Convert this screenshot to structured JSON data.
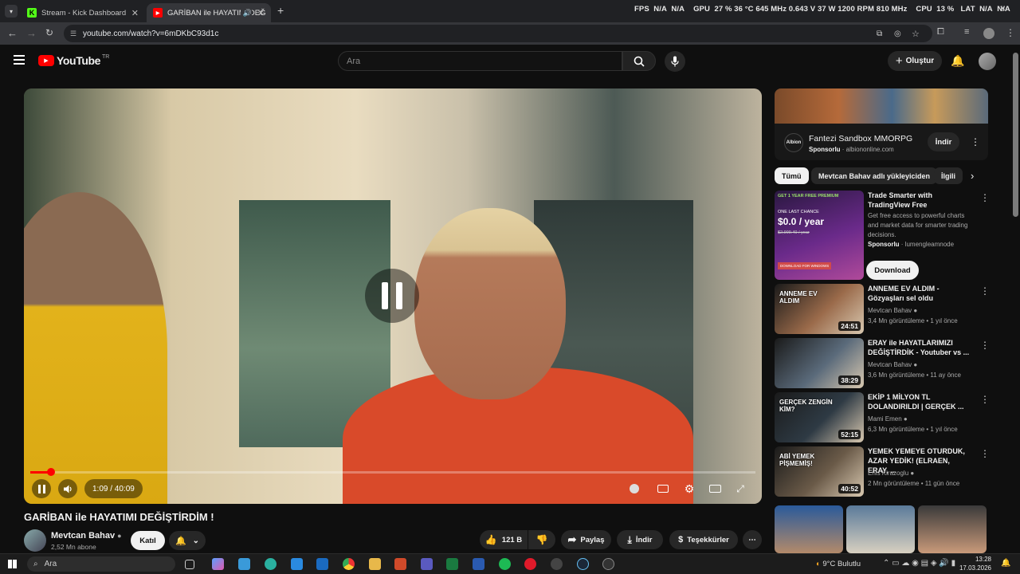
{
  "browser": {
    "tabs": [
      {
        "label": "Stream - Kick Dashboard",
        "favicon_color": "#53fc18"
      },
      {
        "label": "GARİBAN ile HAYATIMI DEĞ",
        "favicon_color": "#ff0000"
      }
    ],
    "new_tab": "+",
    "url": "youtube.com/watch?v=6mDKbC93d1c"
  },
  "overlay": {
    "fps_label": "FPS",
    "fps_1": "N/A",
    "fps_2": "N/A",
    "gpu_label": "GPU",
    "gpu_stats": "27 %  36 °C  645 MHz  0.643 V  37 W  1200 RPM  810 MHz",
    "cpu_label": "CPU",
    "cpu_stats": "13 %",
    "lat_label": "LAT",
    "lat_1": "N/A",
    "lat_2": "N/A"
  },
  "youtube": {
    "logo": "YouTube",
    "country": "TR",
    "search_placeholder": "Ara",
    "create_label": "Oluştur"
  },
  "player": {
    "time": "1:09 / 40:09",
    "progress": 0.029
  },
  "video": {
    "title": "GARİBAN ile HAYATIMI DEĞİŞTİRDİM !",
    "channel": "Mevtcan Bahav",
    "subscribers": "2,52 Mn abone",
    "join": "Katıl",
    "likes": "121 B",
    "share": "Paylaş",
    "download": "İndir",
    "thanks": "Teşekkürler"
  },
  "ad": {
    "title": "Fantezi Sandbox MMORPG",
    "sponsored": "Sponsorlu",
    "domain": "albiononline.com",
    "button": "İndir",
    "logo": "Albion"
  },
  "chips": [
    "Tümü",
    "Mevtcan Bahav adlı yükleyiciden",
    "İlgili"
  ],
  "sponsored_card": {
    "title": "Trade Smarter with TradingView Free",
    "desc": "Get free access to powerful charts and market data for smarter trading decisions.",
    "sponsored": "Sponsorlu",
    "advertiser": "lumengleamnode",
    "button": "Download",
    "thumb_top": "GET 1 YEAR FREE PREMIUM",
    "thumb_mid": "ONE LAST CHANCE",
    "thumb_price": "$0.0 / year",
    "thumb_old": "$2,999.40 / year",
    "thumb_btn": "DOWNLOAD FOR WINDOWS"
  },
  "recommendations": [
    {
      "title": "ANNEME EV ALDIM - Gözyaşları sel oldu",
      "channel": "Mevtcan Bahav",
      "meta": "3,4 Mn görüntüleme • 1 yıl önce",
      "duration": "24:51",
      "thumb_text": "ANNEME EV ALDIM",
      "color": "#9a6a4a"
    },
    {
      "title": "ERAY ile HAYATLARIMIZI DEĞİŞTİRDİK - Youtuber vs ...",
      "channel": "Mevtcan Bahav",
      "meta": "3,6 Mn görüntüleme • 11 ay önce",
      "duration": "38:29",
      "thumb_text": "",
      "color": "#5a6a7a"
    },
    {
      "title": "EKİP 1 MİLYON TL DOLANDIRILDI | GERÇEK ...",
      "channel": "Mami Emen",
      "meta": "6,3 Mn görüntüleme • 1 yıl önce",
      "duration": "52:15",
      "thumb_text": "GERÇEK ZENGİN KİM?",
      "color": "#2e3a44"
    },
    {
      "title": "YEMEK YEMEYE OTURDUK, AZAR YEDİK! (ELRAEN, ERAY, ...",
      "channel": "Enis Kirazoglu",
      "meta": "2 Mn görüntüleme • 11 gün önce",
      "duration": "40:52",
      "thumb_text": "ABİ YEMEK PİŞMEMİŞ!",
      "color": "#6a5a48"
    }
  ],
  "taskbar": {
    "search": "Ara",
    "weather": "9°C  Bulutlu",
    "time": "13:28",
    "date": "17.03.2026"
  }
}
